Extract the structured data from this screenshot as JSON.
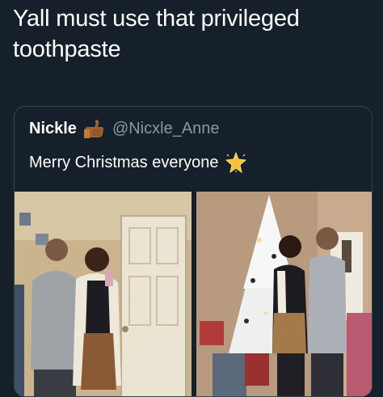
{
  "tweet": {
    "text": "Yall must use that privileged toothpaste"
  },
  "quote": {
    "name": "Nickle",
    "handle": "@Nicxle_Anne",
    "text": "Merry Christmas everyone",
    "name_emoji": "pinching-hand-icon",
    "text_emoji": "glowing-star-icon"
  },
  "photos": [
    {
      "icon": "bathroom-photo"
    },
    {
      "icon": "christmas-tree-photo"
    }
  ],
  "colors": {
    "background": "#15202b",
    "border": "#38444d",
    "handle": "#8899a6",
    "text": "#ffffff"
  }
}
